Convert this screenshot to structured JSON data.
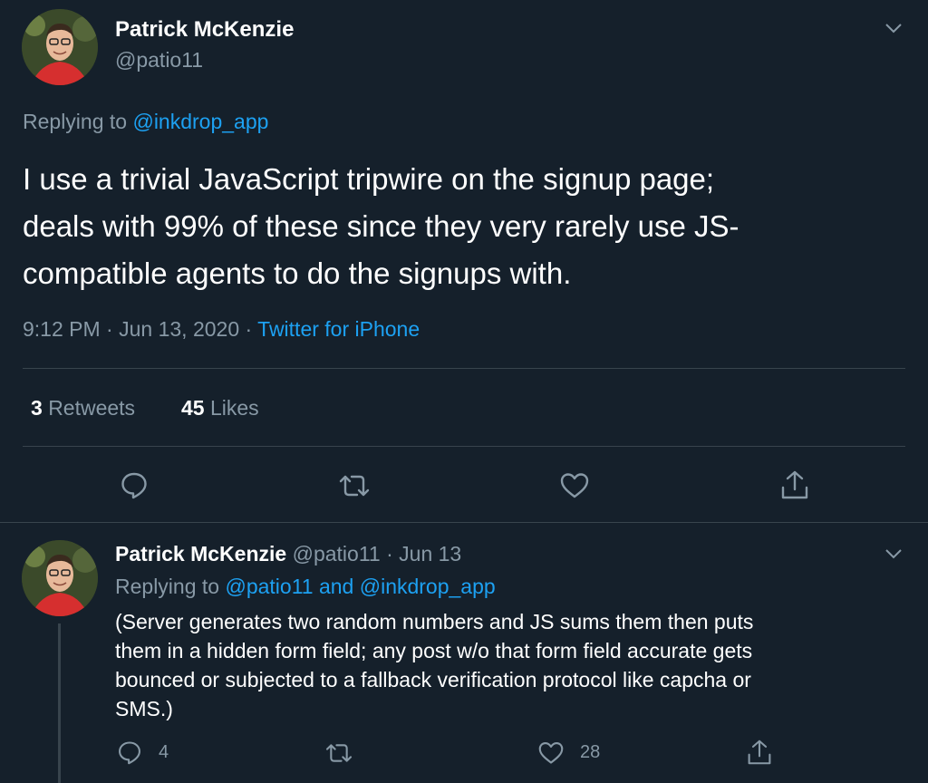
{
  "main_tweet": {
    "author_name": "Patrick McKenzie",
    "handle": "@patio11",
    "replying_prefix": "Replying to",
    "replying_to": "@inkdrop_app",
    "text_lines": [
      "I use a trivial JavaScript tripwire on the signup page;",
      "deals with 99% of these since they very rarely use JS-",
      "compatible agents to do the signups with."
    ],
    "time": "9:12 PM",
    "sep1": "·",
    "date": "Jun 13, 2020",
    "sep2": "·",
    "source": "Twitter for iPhone",
    "retweets_count": "3",
    "retweets_label": "Retweets",
    "likes_count": "45",
    "likes_label": "Likes"
  },
  "reply_tweet": {
    "author_name": "Patrick McKenzie",
    "handle": "@patio11",
    "sep": "·",
    "date": "Jun 13",
    "replying_prefix": "Replying to",
    "replying_to_1": "@patio11",
    "and": "and",
    "replying_to_2": "@inkdrop_app",
    "text_lines": [
      "(Server generates two random numbers and JS sums them then puts",
      "them in a hidden form field; any post w/o that form field accurate gets",
      "bounced or subjected to a fallback verification protocol like capcha or",
      "SMS.)"
    ],
    "reply_count": "4",
    "like_count": "28"
  },
  "colors": {
    "background": "#15202b",
    "text": "#ffffff",
    "muted": "#8899a6",
    "accent": "#1da1f2",
    "divider": "#38444d"
  },
  "icons": [
    "chevron-down-icon",
    "reply-icon",
    "retweet-icon",
    "like-icon",
    "share-icon"
  ]
}
